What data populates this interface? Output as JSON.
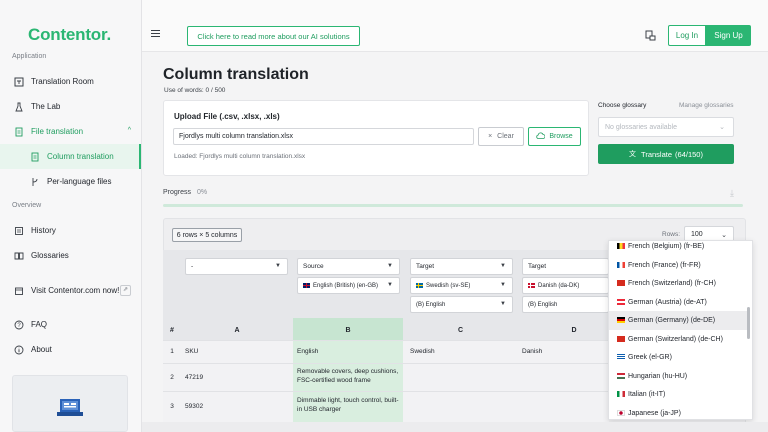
{
  "app": {
    "name": "Contentor."
  },
  "sidebar": {
    "section_application": "Application",
    "section_overview": "Overview",
    "items": {
      "translation_room": "Translation Room",
      "the_lab": "The Lab",
      "file_translation": "File translation",
      "column_translation": "Column translation",
      "per_language_files": "Per-language files",
      "history": "History",
      "glossaries": "Glossaries",
      "visit": "Visit Contentor.com now!",
      "faq": "FAQ",
      "about": "About"
    }
  },
  "topbar": {
    "promo": "Click here to read more about our AI solutions",
    "login": "Log In",
    "signup": "Sign Up"
  },
  "page": {
    "title": "Column translation",
    "usage": "Use of words: 0 / 500"
  },
  "upload": {
    "title": "Upload File (.csv, .xlsx, .xls)",
    "file_name": "Fjordlys multi column translation.xlsx",
    "clear": "Clear",
    "browse": "Browse",
    "loaded": "Loaded: Fjordlys multi column translation.xlsx"
  },
  "glossary": {
    "label": "Choose glossary",
    "manage": "Manage glossaries",
    "placeholder": "No glossaries available",
    "translate": "Translate",
    "translate_count": "(64/150)"
  },
  "progress": {
    "label": "Progress",
    "value": "0%"
  },
  "table": {
    "dims": "6 rows × 5 columns",
    "rows_label": "Rows:",
    "rows_value": "100",
    "col_a_select": "-",
    "col_b_role": "Source",
    "col_b_lang": "English (British) (en-GB)",
    "col_c_role": "Target",
    "col_c_lang": "Swedish (sv-SE)",
    "col_c_base": "(B) English",
    "col_d_role": "Target",
    "col_d_lang": "Danish (da-DK)",
    "col_d_base": "(B) English",
    "headers": {
      "num": "#",
      "a": "A",
      "b": "B",
      "c": "C",
      "d": "D"
    },
    "rows": [
      {
        "n": "1",
        "a": "SKU",
        "b": "English",
        "c": "Swedish",
        "d": "Danish"
      },
      {
        "n": "2",
        "a": "47219",
        "b": "Removable covers, deep cushions, FSC-certified wood frame",
        "c": "",
        "d": ""
      },
      {
        "n": "3",
        "a": "59302",
        "b": "Dimmable light, touch control, built-in USB charger",
        "c": "",
        "d": ""
      }
    ]
  },
  "dropdown": {
    "items": [
      "French (Belgium) (fr-BE)",
      "French (France) (fr-FR)",
      "French (Switzerland) (fr-CH)",
      "German (Austria) (de-AT)",
      "German (Germany) (de-DE)",
      "German (Switzerland) (de-CH)",
      "Greek (el-GR)",
      "Hungarian (hu-HU)",
      "Italian (it-IT)",
      "Japanese (ja-JP)"
    ],
    "selected_index": 4
  },
  "colors": {
    "brand": "#2bb673",
    "brand_dark": "#1f9d5f"
  }
}
